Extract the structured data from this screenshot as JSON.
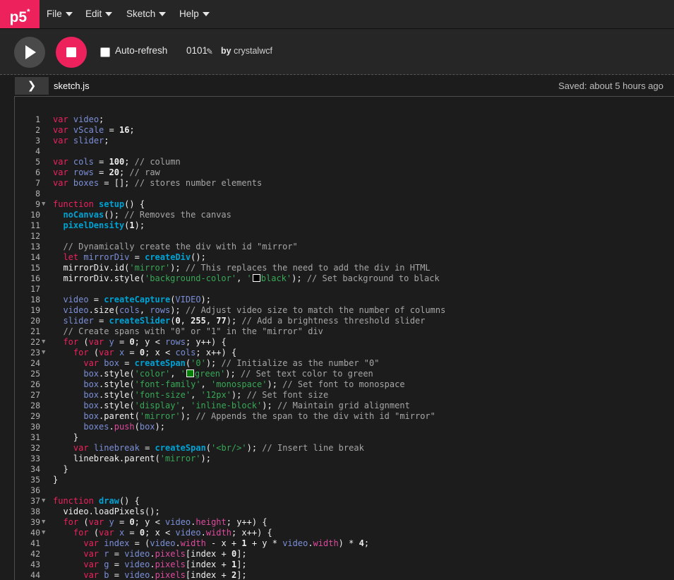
{
  "logo": "p5*",
  "menu": {
    "file": "File",
    "edit": "Edit",
    "sketch": "Sketch",
    "help": "Help"
  },
  "toolbar": {
    "play_icon": "play-icon",
    "stop_icon": "stop-icon",
    "auto_refresh": "Auto-refresh",
    "auto_refresh_checked": false,
    "project_name": "0101",
    "by_label": "by",
    "author": "crystalwcf"
  },
  "editor": {
    "file_name": "sketch.js",
    "saved_status": "Saved: about 5 hours ago",
    "fold_lines": [
      9,
      22,
      23,
      37,
      39,
      40
    ],
    "lines": [
      "var video;",
      "var vScale = 16;",
      "var slider;",
      "",
      "var cols = 100; // column",
      "var rows = 20; // raw",
      "var boxes = []; // stores number elements",
      "",
      "function setup() {",
      "  noCanvas(); // Removes the canvas",
      "  pixelDensity(1);",
      "",
      "  // Dynamically create the div with id \"mirror\"",
      "  let mirrorDiv = createDiv();",
      "  mirrorDiv.id('mirror'); // This replaces the need to add the div in HTML",
      "  mirrorDiv.style('background-color', '■black'); // Set background to black",
      "",
      "  video = createCapture(VIDEO);",
      "  video.size(cols, rows); // Adjust video size to match the number of columns",
      "  slider = createSlider(0, 255, 77); // Add a brightness threshold slider",
      "  // Create spans with \"0\" or \"1\" in the \"mirror\" div",
      "  for (var y = 0; y < rows; y++) {",
      "    for (var x = 0; x < cols; x++) {",
      "      var box = createSpan('0'); // Initialize as the number \"0\"",
      "      box.style('color', '■green'); // Set text color to green",
      "      box.style('font-family', 'monospace'); // Set font to monospace",
      "      box.style('font-size', '12px'); // Set font size",
      "      box.style('display', 'inline-block'); // Maintain grid alignment",
      "      box.parent('mirror'); // Appends the span to the div with id \"mirror\"",
      "      boxes.push(box);",
      "    }",
      "    var linebreak = createSpan('<br/>'); // Insert line break",
      "    linebreak.parent('mirror');",
      "  }",
      "}",
      "",
      "function draw() {",
      "  video.loadPixels();",
      "  for (var y = 0; y < video.height; y++) {",
      "    for (var x = 0; x < video.width; x++) {",
      "      var index = (video.width - x + 1 + y * video.width) * 4;",
      "      var r = video.pixels[index + 0];",
      "      var g = video.pixels[index + 1];",
      "      var b = video.pixels[index + 2];"
    ]
  }
}
